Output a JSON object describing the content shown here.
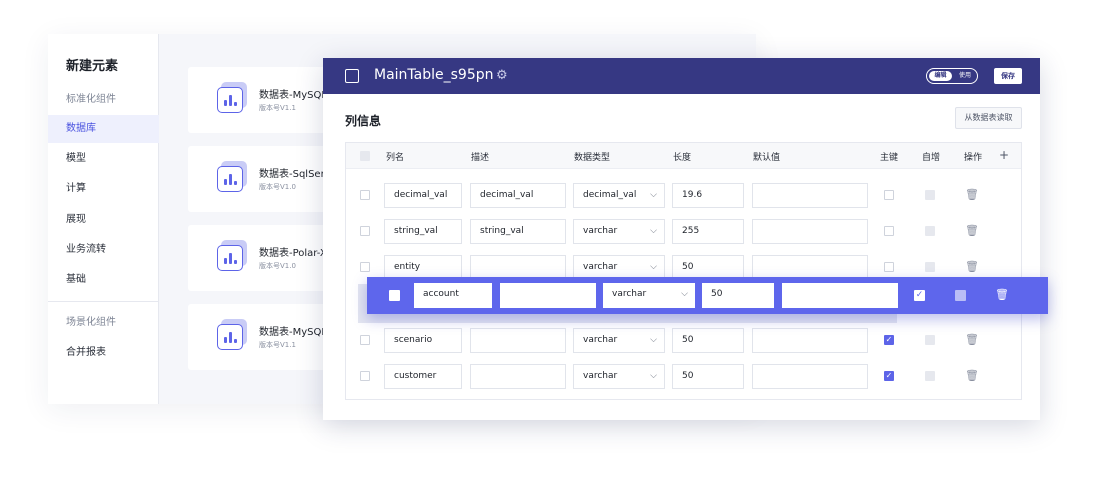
{
  "side_menu": {
    "title": "新建元素",
    "items": [
      {
        "label": "标准化组件"
      },
      {
        "label": "数据库"
      },
      {
        "label": "模型"
      },
      {
        "label": "计算"
      },
      {
        "label": "展现"
      },
      {
        "label": "业务流转"
      },
      {
        "label": "基础"
      },
      {
        "label": "场景化组件"
      },
      {
        "label": "合并报表"
      }
    ]
  },
  "cards": [
    {
      "title": "数据表-MySQL",
      "version": "版本号V1.1"
    },
    {
      "title": "数据表-SqlServ",
      "version": "版本号V1.0"
    },
    {
      "title": "数据表-Polar-X",
      "version": "版本号V1.0"
    },
    {
      "title": "数据表-MySQL",
      "version": "版本号V1.1"
    }
  ],
  "editor": {
    "title": "MainTable_s95pn",
    "mode_edit": "编辑",
    "mode_use": "使用",
    "save": "保存",
    "section_title": "列信息",
    "read_button": "从数据表读取",
    "columns": {
      "name": "列名",
      "desc": "描述",
      "type": "数据类型",
      "length": "长度",
      "default": "默认值",
      "pk": "主键",
      "auto": "自增",
      "ops": "操作",
      "add": "+"
    },
    "rows": [
      {
        "name": "decimal_val",
        "desc": "decimal_val",
        "type": "decimal_val",
        "length": "19.6",
        "default": "",
        "pk": false
      },
      {
        "name": "string_val",
        "desc": "string_val",
        "type": "varchar",
        "length": "255",
        "default": "",
        "pk": false
      },
      {
        "name": "entity",
        "desc": "",
        "type": "varchar",
        "length": "50",
        "default": "",
        "pk": false
      },
      {
        "name": "scenario",
        "desc": "",
        "type": "varchar",
        "length": "50",
        "default": "",
        "pk": true
      },
      {
        "name": "customer",
        "desc": "",
        "type": "varchar",
        "length": "50",
        "default": "",
        "pk": true
      }
    ],
    "dragged_row": {
      "name": "account",
      "desc": "",
      "type": "varchar",
      "length": "50",
      "default": "",
      "pk": true
    }
  },
  "icons": {
    "gear": "⚙",
    "caret": "⌵",
    "trash": "🗑",
    "check": "✓"
  },
  "colors": {
    "header": "#363883",
    "accent": "#5e66ec",
    "active_menu": "#4b53e0"
  }
}
